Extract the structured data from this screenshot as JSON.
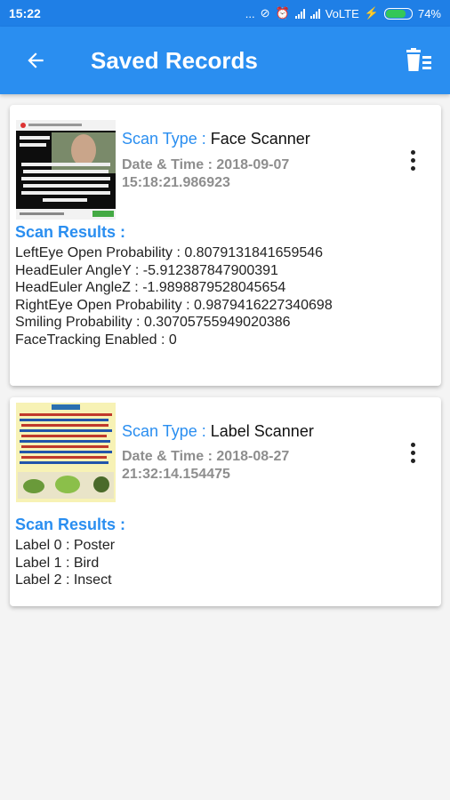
{
  "status": {
    "time": "15:22",
    "dots": "...",
    "network": "VoLTE",
    "battery": "74%"
  },
  "appbar": {
    "title": "Saved Records",
    "back_icon": "arrow-back-icon",
    "delete_icon": "delete-all-icon"
  },
  "records": [
    {
      "scan_type_label": "Scan Type : ",
      "scan_type": "Face Scanner",
      "datetime": "Date & Time : 2018-09-07 15:18:21.986923",
      "results_title": "Scan Results :",
      "results": [
        "LeftEye Open Probability : 0.8079131841659546",
        "HeadEuler AngleY : -5.912387847900391",
        "HeadEuler AngleZ : -1.9898879528045654",
        "RightEye Open Probability : 0.9879416227340698",
        "Smiling Probability : 0.30705755949020386",
        "FaceTracking Enabled : 0"
      ]
    },
    {
      "scan_type_label": "Scan Type : ",
      "scan_type": "Label Scanner",
      "datetime": "Date & Time : 2018-08-27 21:32:14.154475",
      "results_title": "Scan Results :",
      "results": [
        "Label 0 : Poster",
        "Label 1 : Bird",
        "Label 2 : Insect"
      ]
    }
  ]
}
